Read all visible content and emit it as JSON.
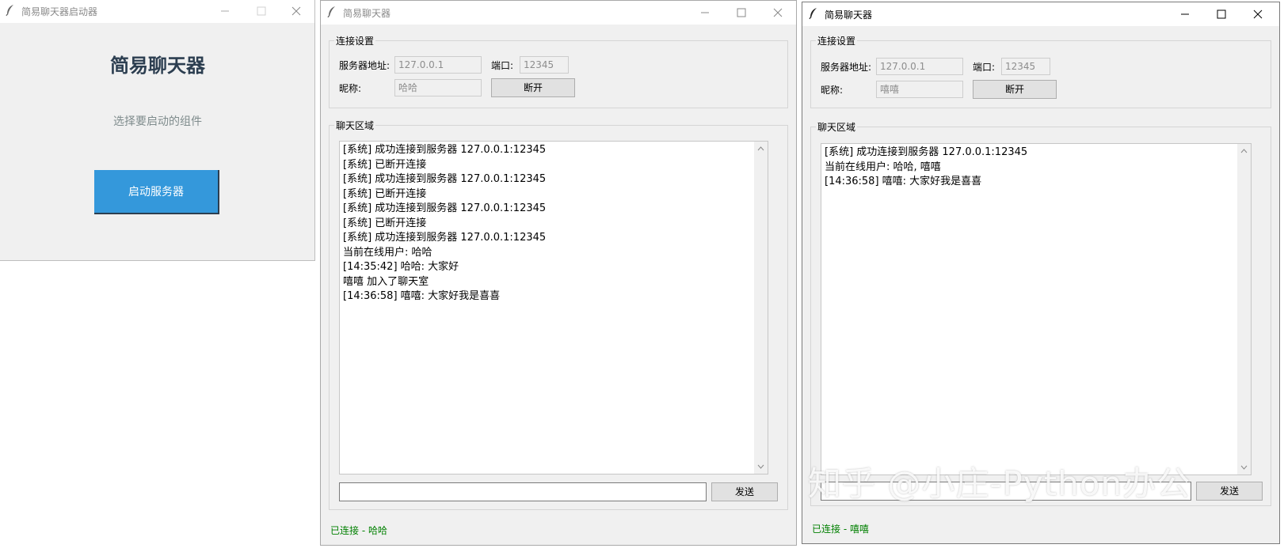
{
  "launcher": {
    "title": "简易聊天器启动器",
    "heading": "简易聊天器",
    "subtitle": "选择要启动的组件",
    "start_server_label": "启动服务器",
    "accent": "#3498db"
  },
  "client1": {
    "title": "简易聊天器",
    "conn_group": "连接设置",
    "server_label": "服务器地址:",
    "server_value": "127.0.0.1",
    "port_label": "端口:",
    "port_value": "12345",
    "nick_label": "昵称:",
    "nick_value": "哈哈",
    "disconnect_label": "断开",
    "chat_group": "聊天区域",
    "messages": [
      "[系统] 成功连接到服务器 127.0.0.1:12345",
      "[系统] 已断开连接",
      "[系统] 成功连接到服务器 127.0.0.1:12345",
      "[系统] 已断开连接",
      "[系统] 成功连接到服务器 127.0.0.1:12345",
      "[系统] 已断开连接",
      "[系统] 成功连接到服务器 127.0.0.1:12345",
      "当前在线用户: 哈哈",
      "[14:35:42] 哈哈: 大家好",
      "嘻嘻 加入了聊天室",
      "[14:36:58] 嘻嘻: 大家好我是喜喜"
    ],
    "message_input": "",
    "send_label": "发送",
    "status": "已连接 - 哈哈"
  },
  "client2": {
    "title": "简易聊天器",
    "conn_group": "连接设置",
    "server_label": "服务器地址:",
    "server_value": "127.0.0.1",
    "port_label": "端口:",
    "port_value": "12345",
    "nick_label": "昵称:",
    "nick_value": "嘻嘻",
    "disconnect_label": "断开",
    "chat_group": "聊天区域",
    "messages": [
      "[系统] 成功连接到服务器 127.0.0.1:12345",
      "当前在线用户: 哈哈, 嘻嘻",
      "[14:36:58] 嘻嘻: 大家好我是喜喜"
    ],
    "message_input": "",
    "send_label": "发送",
    "status": "已连接 - 嘻嘻"
  },
  "watermark": "知乎 @小庄-Python办公",
  "colors": {
    "status_green": "#008000"
  }
}
